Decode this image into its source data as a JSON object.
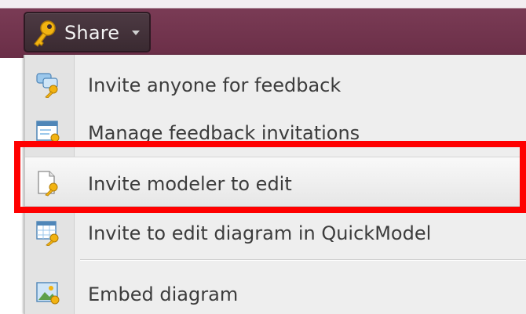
{
  "share_button": {
    "label": "Share",
    "icon": "key-icon",
    "caret_icon": "chevron-down-icon"
  },
  "menu": {
    "items": [
      {
        "label": "Invite anyone for feedback",
        "icon": "chat-bubbles-key-icon"
      },
      {
        "label": "Manage feedback invitations",
        "icon": "window-key-icon"
      },
      {
        "label": "Invite modeler to edit",
        "icon": "document-key-icon",
        "highlighted": true
      },
      {
        "label": "Invite to edit diagram in QuickModel",
        "icon": "grid-key-icon"
      },
      {
        "label": "Embed diagram",
        "icon": "embed-image-icon"
      }
    ]
  },
  "colors": {
    "topbar": "#6a2e47",
    "button_bg": "#3a2a31",
    "menu_bg": "#eeeeee",
    "highlight": "#ff0000",
    "text": "#3c3c3c"
  }
}
